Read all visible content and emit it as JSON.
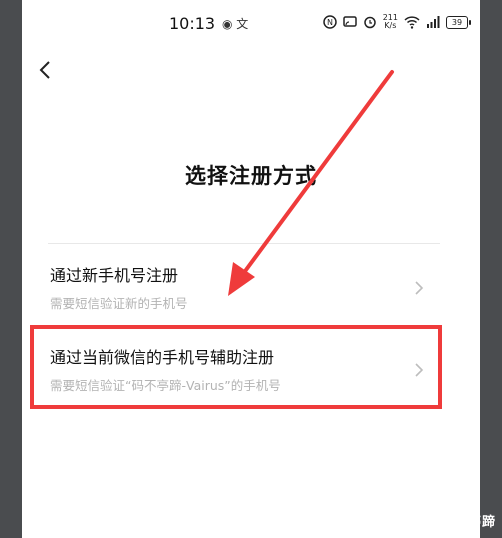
{
  "status_bar": {
    "time": "10:13",
    "left_icons": "◉ 文",
    "net_speed_value": "211",
    "net_speed_unit": "K/s",
    "battery": "39"
  },
  "page": {
    "title": "选择注册方式"
  },
  "options": [
    {
      "title": "通过新手机号注册",
      "subtitle": "需要短信验证新的手机号"
    },
    {
      "title": "通过当前微信的手机号辅助注册",
      "subtitle": "需要短信验证“码不亭蹄-Vairus”的手机号"
    }
  ],
  "annotation": {
    "highlight_color": "#ef3b3b"
  },
  "watermark": "码不亭蹄"
}
